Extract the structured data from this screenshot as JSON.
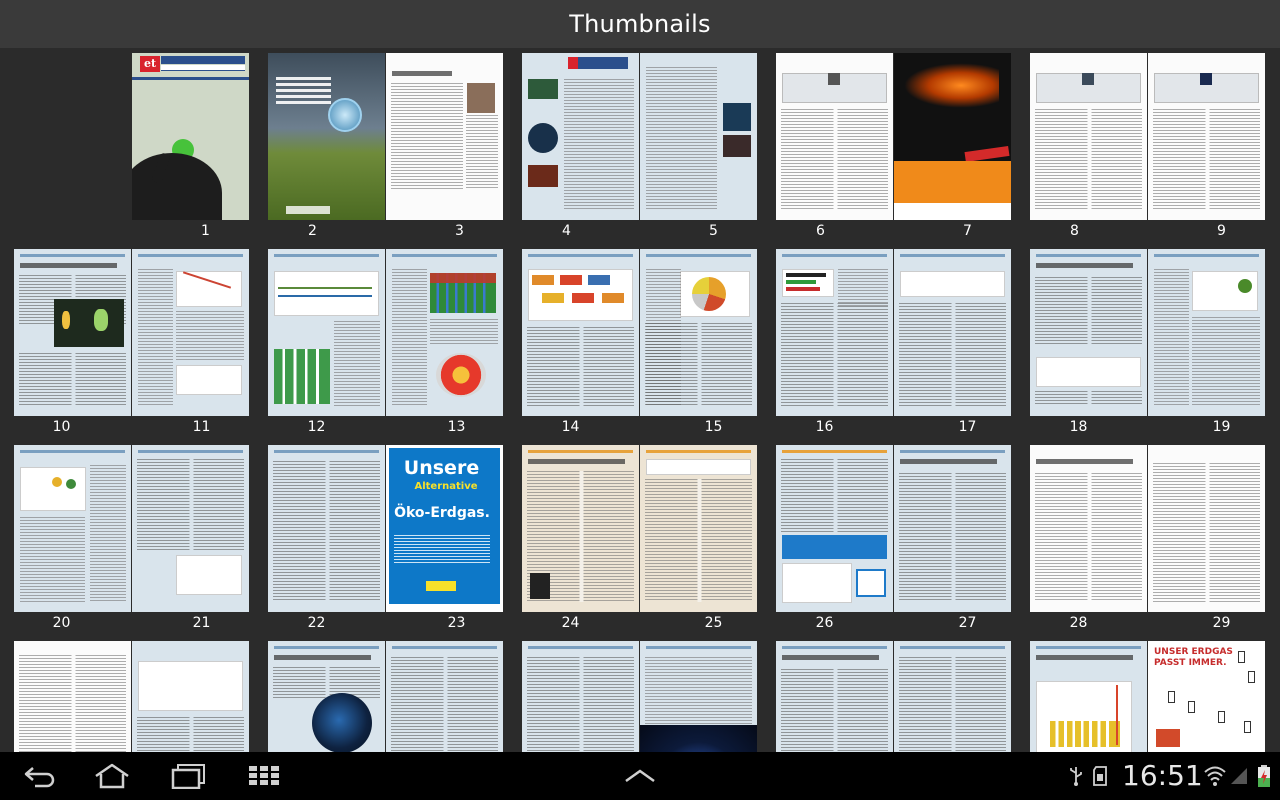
{
  "header": {
    "title": "Thumbnails"
  },
  "pages": [
    "1",
    "2",
    "3",
    "4",
    "5",
    "6",
    "7",
    "8",
    "9",
    "10",
    "11",
    "12",
    "13",
    "14",
    "15",
    "16",
    "17",
    "18",
    "19",
    "20",
    "21",
    "22",
    "23",
    "24",
    "25",
    "26",
    "27",
    "28",
    "29"
  ],
  "covers": {
    "p23": {
      "line1": "Unsere",
      "line2": "Alternative",
      "line3": "Öko-Erdgas."
    },
    "p29": {
      "headline": "UNSER ERDGAS PASST IMMER."
    }
  },
  "status_bar": {
    "time": "16:51"
  },
  "icons": {
    "back": "back-arrow-icon",
    "home": "home-icon",
    "recents": "recent-apps-icon",
    "apps": "app-grid-icon",
    "menu": "chevron-up-icon",
    "usb": "usb-icon",
    "sd": "sd-card-icon",
    "wifi": "wifi-icon",
    "signal": "signal-icon",
    "battery": "battery-icon"
  }
}
